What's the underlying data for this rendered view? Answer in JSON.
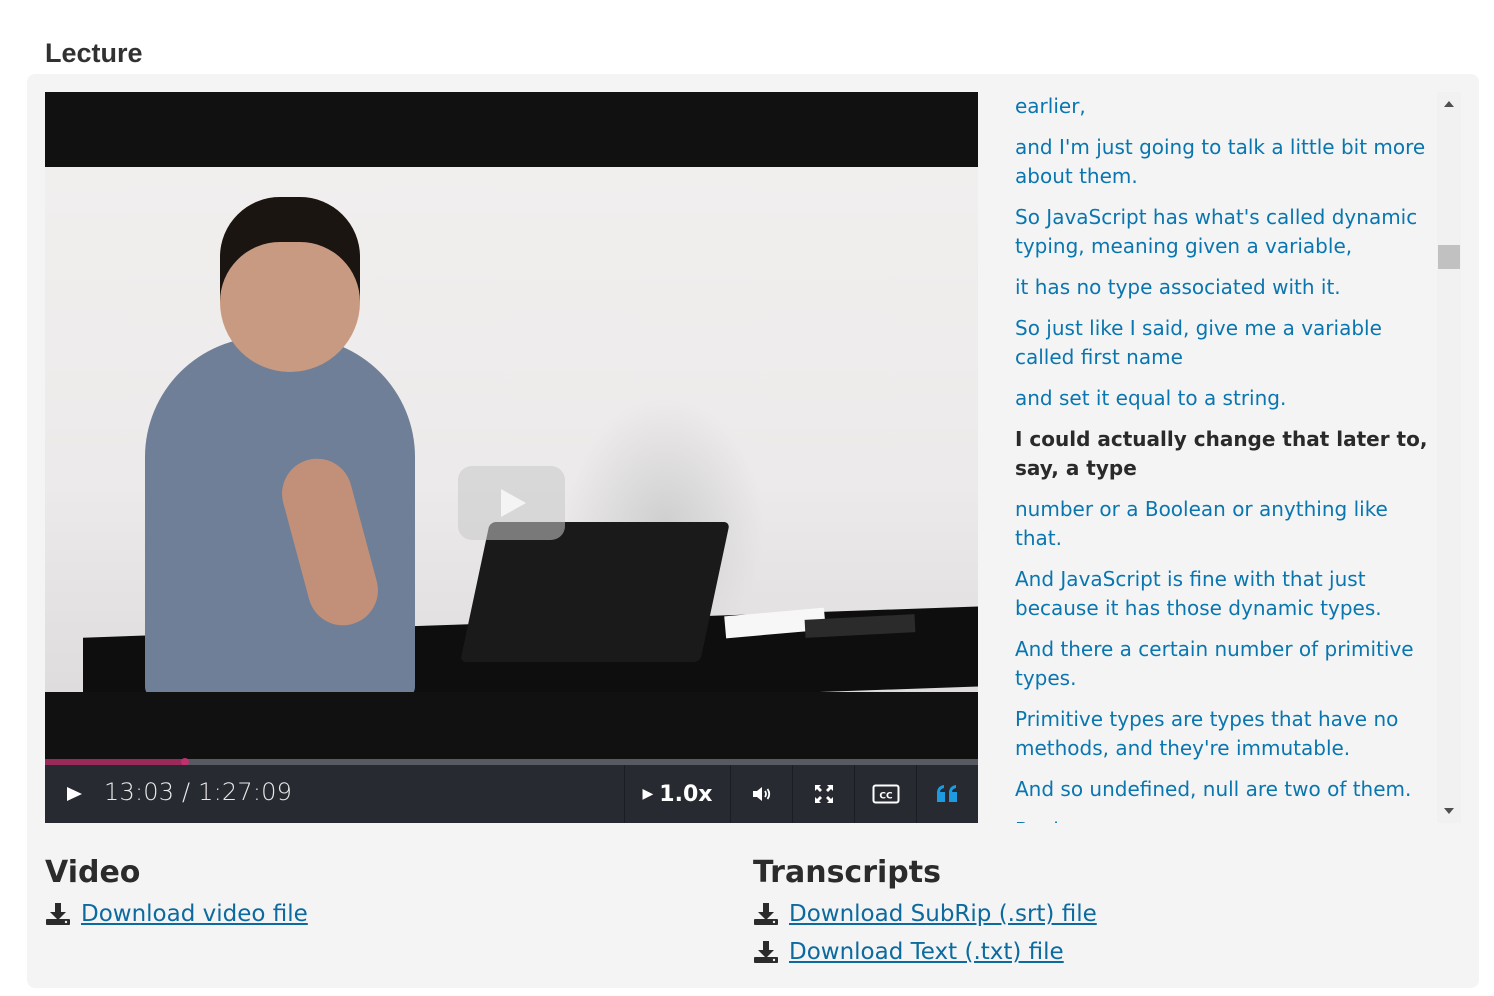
{
  "section": {
    "title": "Lecture"
  },
  "player": {
    "current_time": "13:03",
    "separator": " / ",
    "duration": "1:27:09",
    "progress": 0.15,
    "speed_label": "1.0x",
    "icons": {
      "big_play": "play-icon",
      "play": "play-icon",
      "speed": "caret-right-icon",
      "volume": "volume-icon",
      "fullscreen": "fullscreen-icon",
      "captions": "closed-captions-icon",
      "transcript_toggle": "quote-icon"
    },
    "colors": {
      "progress": "#9a2a5a",
      "controls_bg": "#272b31",
      "transcript_toggle_active": "#1e9be0"
    }
  },
  "transcript": {
    "lines": [
      {
        "text": "earlier,"
      },
      {
        "text": "and I'm just going to talk a little bit more about them."
      },
      {
        "text": "So JavaScript has what's called dynamic typing, meaning given a variable,"
      },
      {
        "text": "it has no type associated with it."
      },
      {
        "text": "So just like I said, give me a variable called first name"
      },
      {
        "text": "and set it equal to a string."
      },
      {
        "text": "I could actually change that later to, say, a type",
        "current": true
      },
      {
        "text": "number or a Boolean or anything like that."
      },
      {
        "text": "And JavaScript is fine with that just because it has those dynamic types."
      },
      {
        "text": "And there a certain number of primitive types."
      },
      {
        "text": "Primitive types are types that have no methods, and they're immutable."
      },
      {
        "text": "And so undefined, null are two of them."
      },
      {
        "text": "Boolean."
      }
    ]
  },
  "downloads": {
    "video": {
      "heading": "Video",
      "links": [
        {
          "label": "Download video file",
          "icon": "download-icon"
        }
      ]
    },
    "transcripts": {
      "heading": "Transcripts",
      "links": [
        {
          "label": "Download SubRip (.srt) file",
          "icon": "download-icon"
        },
        {
          "label": "Download Text (.txt) file",
          "icon": "download-icon"
        }
      ]
    }
  }
}
